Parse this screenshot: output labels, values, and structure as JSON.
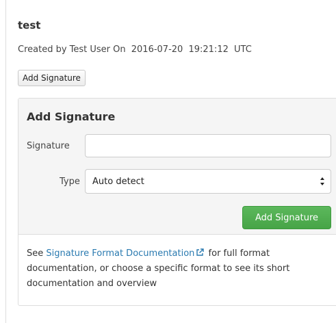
{
  "header": {
    "title": "test",
    "created_by": "Created by Test User On",
    "created_date": "2016-07-20",
    "created_time": "19:21:12",
    "created_tz": "UTC"
  },
  "toolbar": {
    "add_signature_label": "Add Signature"
  },
  "panel": {
    "title": "Add Signature",
    "signature_label": "Signature",
    "signature_value": "",
    "signature_placeholder": "",
    "type_label": "Type",
    "type_selected": "Auto detect",
    "submit_label": "Add Signature"
  },
  "help": {
    "prefix": "See",
    "link_text": "Signature Format Documentation",
    "suffix": "for full format documentation, or choose a specific format to see its short documentation and overview"
  },
  "icons": {
    "external_link": "external-link-icon",
    "select_chevron": "up-down-chevron-icon"
  },
  "colors": {
    "link": "#2a7ab0",
    "submit_button": "#5cb85c",
    "panel_header_bg": "#f5f5f5"
  }
}
